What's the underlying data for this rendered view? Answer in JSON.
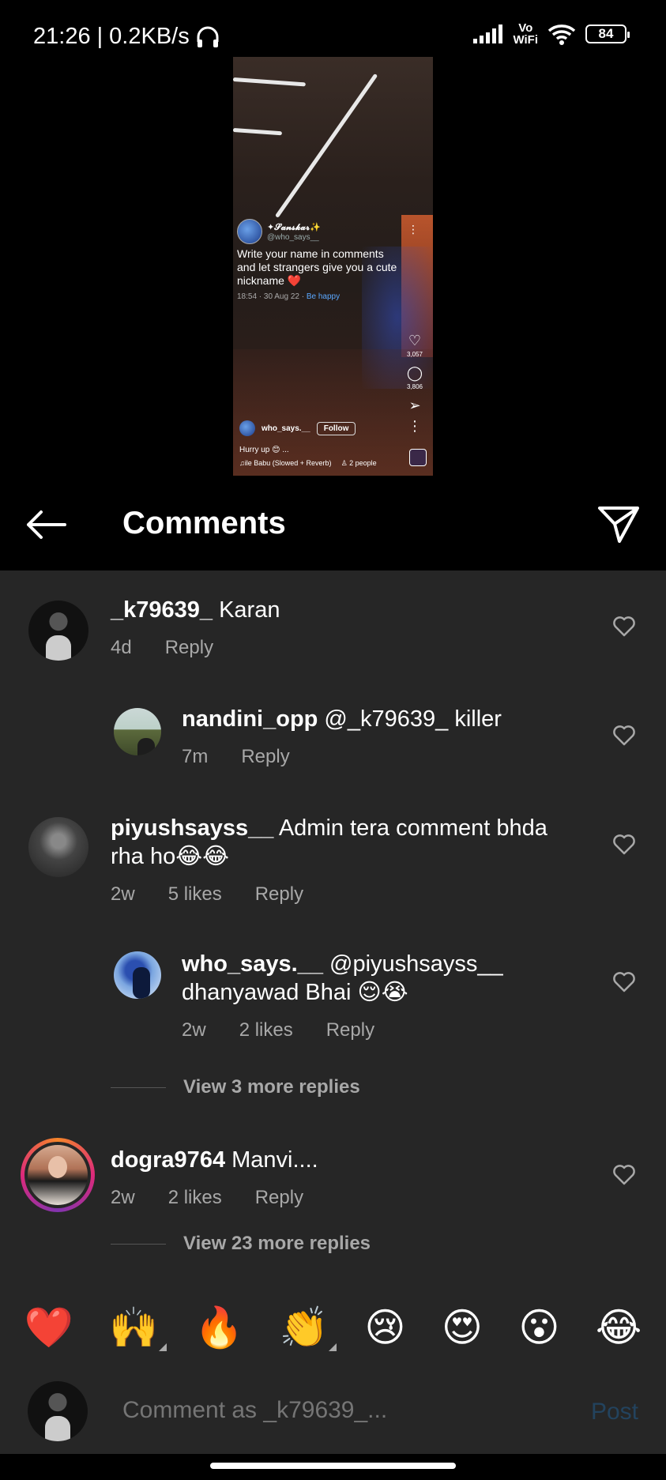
{
  "status_bar": {
    "time": "21:26",
    "speed": "| 0.2KB/s",
    "volte_line1": "Vo",
    "volte_line2": "WiFi",
    "battery": "84"
  },
  "video": {
    "author_name": "✦𝓢𝓪𝓷𝓼𝓴𝓪𝓻✨",
    "author_handle": "@who_says__",
    "post_text": "Write your name in comments and let strangers give you a cute nickname ❤️",
    "post_meta_time": "18:54 · 30 Aug 22 ·",
    "post_meta_tag": "Be happy",
    "like_count": "3,057",
    "comment_count": "3,806",
    "footer_username": "who_says.__",
    "follow_label": "Follow",
    "caption": "Hurry up 😊 ...",
    "audio": "♫ile Babu (Slowed + Reverb)",
    "audio_people": "♙ 2 people"
  },
  "header": {
    "title": "Comments"
  },
  "comments": [
    {
      "username": "_k79639_",
      "text": " Karan",
      "time": "4d",
      "likes": "",
      "reply": "Reply"
    },
    {
      "username": "nandini_opp",
      "text": " @_k79639_ killer",
      "time": "7m",
      "likes": "",
      "reply": "Reply"
    },
    {
      "username": "piyushsayss__",
      "text": " Admin tera comment bhda rha ho😂😂",
      "time": "2w",
      "likes": "5 likes",
      "reply": "Reply"
    },
    {
      "username": "who_says.__",
      "text": " @piyushsayss__ dhanyawad Bhai 😌😭",
      "time": "2w",
      "likes": "2 likes",
      "reply": "Reply"
    },
    {
      "username": "dogra9764",
      "text": " Manvi....",
      "time": "2w",
      "likes": "2 likes",
      "reply": "Reply"
    }
  ],
  "view_more": [
    "View 3 more replies",
    "View 23 more replies"
  ],
  "emoji_bar": [
    "❤️",
    "🙌",
    "🔥",
    "👏",
    "😢",
    "😍",
    "😮",
    "😂"
  ],
  "input": {
    "placeholder": "Comment as _k79639_...",
    "post_label": "Post"
  }
}
